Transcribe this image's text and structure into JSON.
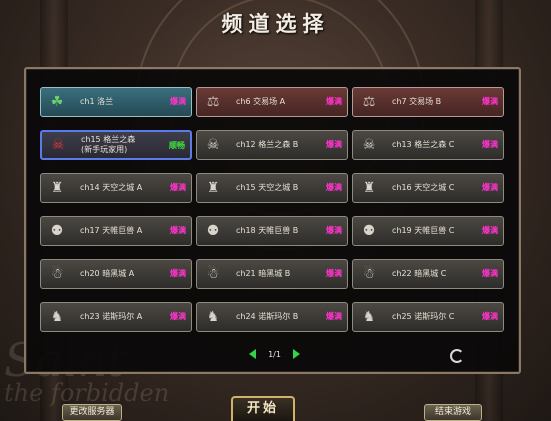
{
  "title": "频道选择",
  "background_text": "Saint\nthe forbidden",
  "channels": [
    {
      "name": "ch1 洛兰",
      "sub": "",
      "status": "爆满",
      "style": "teal",
      "icon": "leaf-icon"
    },
    {
      "name": "ch6 交易场 A",
      "sub": "",
      "status": "爆满",
      "style": "red",
      "icon": "merchant-icon"
    },
    {
      "name": "ch7 交易场 B",
      "sub": "",
      "status": "爆满",
      "style": "red",
      "icon": "merchant-icon"
    },
    {
      "name": "ch15 格兰之森",
      "sub": "(新手玩家用)",
      "status": "顺畅",
      "style": "sel",
      "icon": "goblin-icon"
    },
    {
      "name": "ch12 格兰之森 B",
      "sub": "",
      "status": "爆满",
      "style": "plain",
      "icon": "goblin-icon"
    },
    {
      "name": "ch13 格兰之森 C",
      "sub": "",
      "status": "爆满",
      "style": "plain",
      "icon": "goblin-icon"
    },
    {
      "name": "ch14 天空之城 A",
      "sub": "",
      "status": "爆满",
      "style": "plain",
      "icon": "sky-castle-icon"
    },
    {
      "name": "ch15 天空之城 B",
      "sub": "",
      "status": "爆满",
      "style": "plain",
      "icon": "sky-castle-icon"
    },
    {
      "name": "ch16 天空之城 C",
      "sub": "",
      "status": "爆满",
      "style": "plain",
      "icon": "sky-castle-icon"
    },
    {
      "name": "ch17 天帷巨兽 A",
      "sub": "",
      "status": "爆满",
      "style": "plain",
      "icon": "beast-icon"
    },
    {
      "name": "ch18 天帷巨兽 B",
      "sub": "",
      "status": "爆满",
      "style": "plain",
      "icon": "beast-icon"
    },
    {
      "name": "ch19 天帷巨兽 C",
      "sub": "",
      "status": "爆满",
      "style": "plain",
      "icon": "beast-icon"
    },
    {
      "name": "ch20 暗黑城 A",
      "sub": "",
      "status": "爆满",
      "style": "plain",
      "icon": "dark-city-icon"
    },
    {
      "name": "ch21 暗黑城 B",
      "sub": "",
      "status": "爆满",
      "style": "plain",
      "icon": "dark-city-icon"
    },
    {
      "name": "ch22 暗黑城 C",
      "sub": "",
      "status": "爆满",
      "style": "plain",
      "icon": "dark-city-icon"
    },
    {
      "name": "ch23 诺斯玛尔 A",
      "sub": "",
      "status": "爆满",
      "style": "plain",
      "icon": "knight-icon"
    },
    {
      "name": "ch24 诺斯玛尔 B",
      "sub": "",
      "status": "爆满",
      "style": "plain",
      "icon": "knight-icon"
    },
    {
      "name": "ch25 诺斯玛尔 C",
      "sub": "",
      "status": "爆满",
      "style": "plain",
      "icon": "knight-icon"
    }
  ],
  "pager": {
    "page": "1/1"
  },
  "buttons": {
    "left": "更改服务器",
    "start": "开始",
    "right": "结束游戏"
  },
  "colors": {
    "status_full": "#ff33cc",
    "status_smooth": "#3fe03f",
    "selected_border": "#5a7be8",
    "page_arrow": "#33d44a"
  }
}
